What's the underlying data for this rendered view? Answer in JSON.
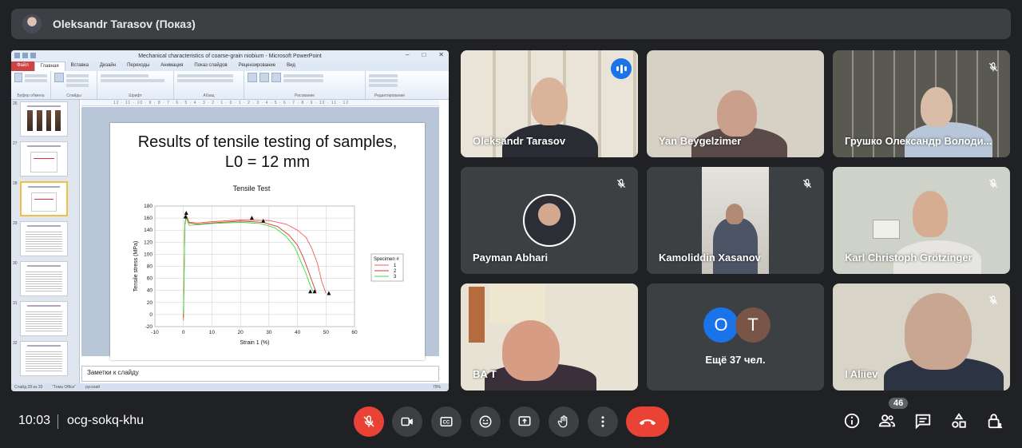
{
  "topbar": {
    "presenter": "Oleksandr Tarasov (Показ)"
  },
  "ppt": {
    "window_title": "Mechanical characteristics of coarse-grain niobium - Microsoft PowerPoint",
    "tabs": [
      "Файл",
      "Главная",
      "Вставка",
      "Дизайн",
      "Переходы",
      "Анимация",
      "Показ слайдов",
      "Рецензирование",
      "Вид"
    ],
    "ribbon_groups": [
      "Буфер обмена",
      "Слайды",
      "Шрифт",
      "Абзац",
      "Рисование",
      "Редактирование"
    ],
    "thumb_numbers": [
      "26",
      "27",
      "28",
      "29",
      "30",
      "31",
      "32"
    ],
    "slide_title_line1": "Results of tensile testing of samples,",
    "slide_title_line2": "L0 = 12 mm",
    "notes": "Заметки к слайду",
    "status_left": "Слайд 28 из 33",
    "status_theme": "\"Тема Office\"",
    "status_lang": "русский",
    "zoom": "79%"
  },
  "chart_data": {
    "type": "line",
    "title": "Tensile Test",
    "xlabel": "Strain 1 (%)",
    "ylabel": "Tensile stress (MPa)",
    "xlim": [
      -10,
      60
    ],
    "ylim": [
      -20,
      180
    ],
    "xticks": [
      -10,
      0,
      10,
      20,
      30,
      40,
      50,
      60
    ],
    "yticks": [
      -20,
      0,
      20,
      40,
      60,
      80,
      100,
      120,
      140,
      160,
      180
    ],
    "legend_title": "Specimen #",
    "legend_position": "right",
    "grid": true,
    "series": [
      {
        "name": "1",
        "color": "#e8605a",
        "x": [
          0,
          0.5,
          1,
          2,
          5,
          10,
          20,
          30,
          36,
          40,
          43,
          45,
          47,
          48.5,
          50
        ],
        "y": [
          -10,
          150,
          162,
          153,
          152,
          154,
          157,
          156,
          150,
          140,
          128,
          110,
          85,
          55,
          35
        ]
      },
      {
        "name": "2",
        "color": "#d23a3a",
        "x": [
          0,
          0.5,
          1,
          2,
          5,
          10,
          20,
          28,
          33,
          37,
          40,
          42,
          44,
          45.5,
          46.5
        ],
        "y": [
          -5,
          148,
          165,
          152,
          150,
          152,
          155,
          153,
          146,
          132,
          115,
          95,
          70,
          50,
          38
        ]
      },
      {
        "name": "3",
        "color": "#3ddc3d",
        "x": [
          0,
          0.5,
          1,
          2,
          5,
          10,
          20,
          27,
          32,
          36,
          39,
          41,
          43,
          44.5,
          45.5
        ],
        "y": [
          0,
          152,
          160,
          148,
          149,
          151,
          153,
          151,
          144,
          130,
          112,
          90,
          68,
          48,
          38
        ]
      }
    ],
    "markers": {
      "x": [
        1,
        0.7,
        24,
        28,
        44.5,
        46,
        51
      ],
      "y": [
        168,
        162,
        160,
        155,
        38,
        38,
        35
      ]
    }
  },
  "participants": [
    {
      "name": "Oleksandr Tarasov",
      "speaking": true
    },
    {
      "name": "Yan Beygelzimer",
      "muted": false
    },
    {
      "name": "Грушко Олександр Володи...",
      "muted": true
    },
    {
      "name": "Payman Abhari",
      "muted": true
    },
    {
      "name": "Kamoliddin Xasanov",
      "muted": true
    },
    {
      "name": "Karl Christoph Grötzinger",
      "muted": true
    },
    {
      "name": "BA T",
      "muted": false
    },
    {
      "name": "l Aliiev",
      "muted": true
    }
  ],
  "others": {
    "letters": [
      "O",
      "T"
    ],
    "letter_colors": [
      "#1a73e8",
      "#795548"
    ],
    "label": "Ещё 37 чел."
  },
  "bottom": {
    "time": "10:03",
    "meeting_code": "ocg-sokq-khu",
    "participant_count": "46"
  },
  "colors": {
    "mic_off": "#ea4335",
    "end_call": "#ea4335",
    "speaking_ring": "#8ab4f8"
  }
}
